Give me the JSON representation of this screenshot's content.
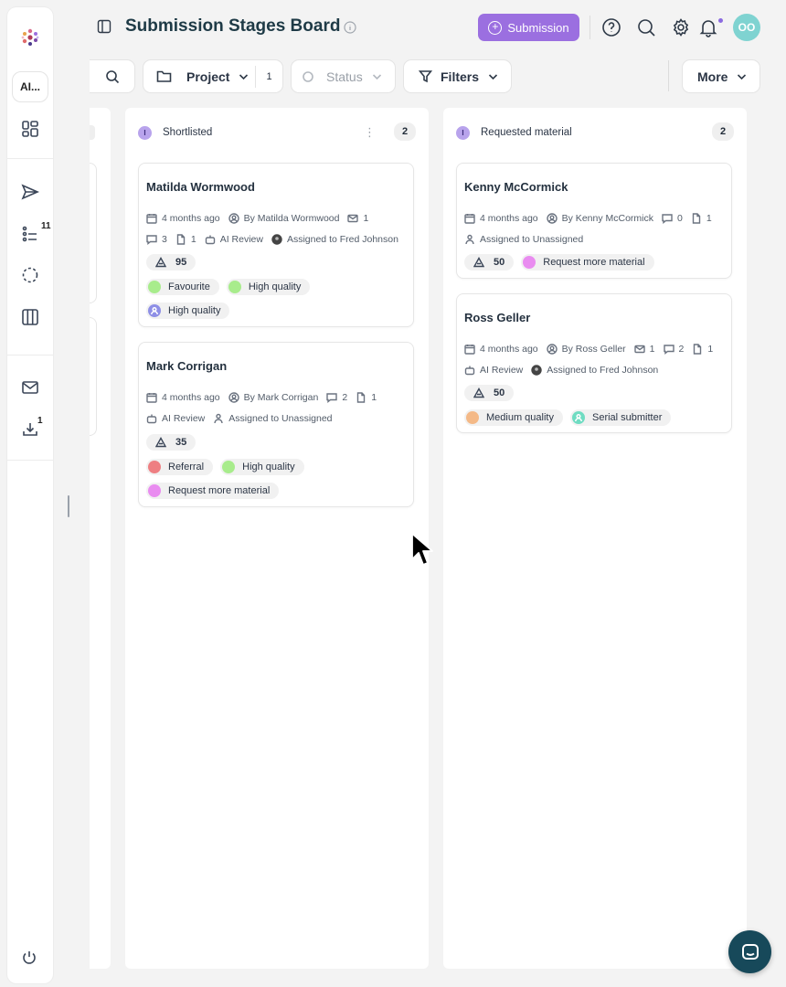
{
  "header": {
    "title": "Submission Stages Board",
    "submission_button": "Submission",
    "avatar_initials": "OO"
  },
  "sidebar": {
    "ai_label": "AI...",
    "badge_tasks": "11",
    "badge_downloads": "1"
  },
  "toolbar": {
    "project_label": "Project",
    "project_count": "1",
    "status_label": "Status",
    "filters_label": "Filters",
    "more_label": "More"
  },
  "columns": [
    {
      "dot": "I",
      "name": "Shortlisted",
      "count": "2",
      "cards": [
        {
          "title": "Matilda Wormwood",
          "time": "4 months ago",
          "author": "By Matilda Wormwood",
          "mail_count": "1",
          "comment_count": "3",
          "file_count": "1",
          "stage": "AI Review",
          "assigned": "Assigned to Fred Johnson",
          "score": "95",
          "tags": [
            "Favourite",
            "High quality",
            "High quality"
          ]
        },
        {
          "title": "Mark Corrigan",
          "time": "4 months ago",
          "author": "By Mark Corrigan",
          "comment_count": "2",
          "file_count": "1",
          "stage": "AI Review",
          "assigned": "Assigned to Unassigned",
          "score": "35",
          "tags": [
            "Referral",
            "High quality",
            "Request more material"
          ]
        }
      ]
    },
    {
      "dot": "I",
      "name": "Requested material",
      "count": "2",
      "cards": [
        {
          "title": "Kenny McCormick",
          "time": "4 months ago",
          "author": "By Kenny McCormick",
          "comment_count": "0",
          "file_count": "1",
          "assigned": "Assigned to Unassigned",
          "score": "50",
          "tags": [
            "Request more material"
          ]
        },
        {
          "title": "Ross Geller",
          "time": "4 months ago",
          "author": "By Ross Geller",
          "mail_count": "1",
          "comment_count": "2",
          "file_count": "1",
          "stage": "AI Review",
          "assigned": "Assigned to Fred Johnson",
          "score": "50",
          "tags": [
            "Medium quality",
            "Serial submitter"
          ]
        }
      ]
    }
  ],
  "colors": {
    "accent": "#9b6fe0",
    "green": "#a8ec8c",
    "red": "#ee7f82",
    "pink": "#e98cf0",
    "orange": "#f4b987",
    "teal_person": "#6fdcc2",
    "indigo_person": "#8e8fe6",
    "chat": "#17495a"
  }
}
